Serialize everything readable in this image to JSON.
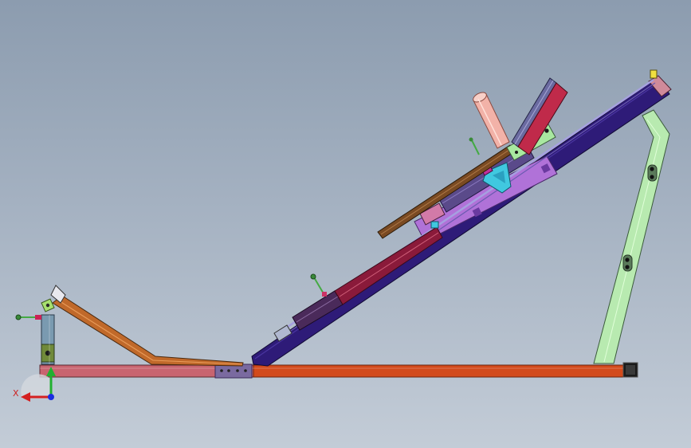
{
  "viewport": {
    "background_top": "#8c9caf",
    "background_bottom": "#c3ccd7"
  },
  "triad": {
    "x_axis_label": "X",
    "x_color": "#d42020",
    "y_color": "#20b030",
    "z_color": "#1a2ee0"
  },
  "parts": {
    "base_rail_color": "#d24a1c",
    "base_rail_left_color": "#c86470",
    "incline_frame_color": "#2e1b78",
    "incline_panel_color": "#b072d8",
    "rear_strut_color": "#b8eab0",
    "front_arm_color": "#c0692a",
    "front_post_color": "#7a9ab0",
    "seat_bar_color": "#7a4a22",
    "handle_grip_color": "#f2b2a8",
    "back_pad_color": "#c02a4a",
    "cylinder_color": "#4a2a5a",
    "bracket_color": "#40c8e0",
    "green_bracket_color": "#a8e8a0",
    "joint_plate_color": "#7a6aa0"
  }
}
